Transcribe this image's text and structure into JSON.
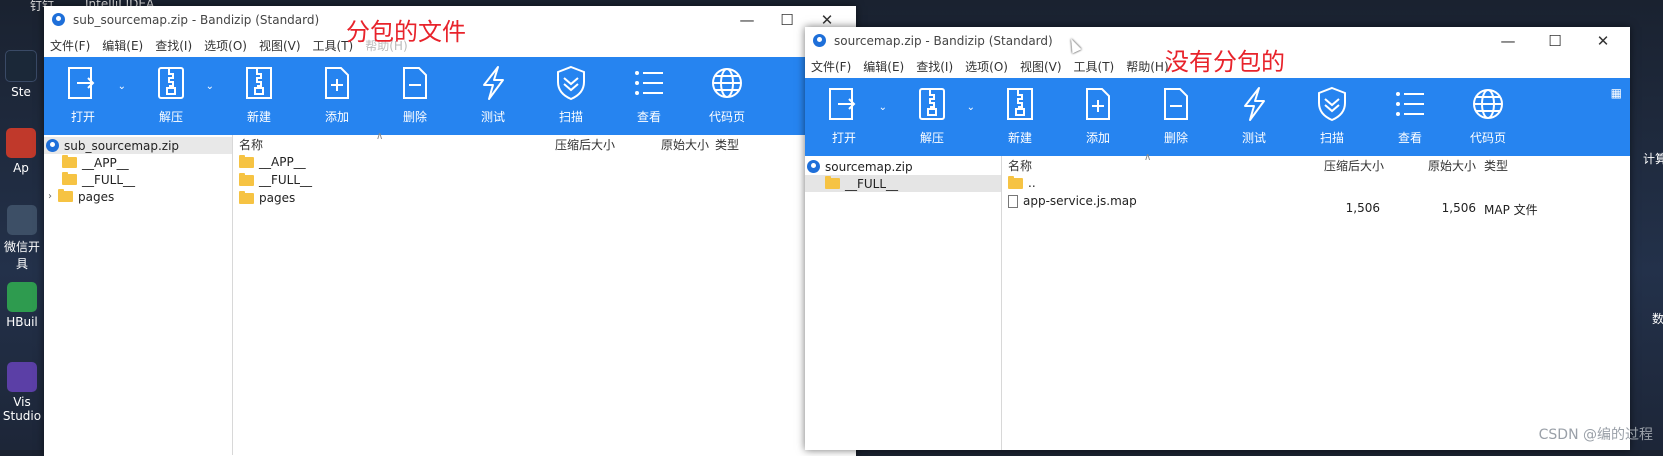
{
  "desktop": {
    "top_left_label": "钉钉",
    "top_right_label": "IntelliJ IDEA",
    "icons": [
      {
        "label": "Ste",
        "icon": "steam-icon",
        "color": "#1b2838"
      },
      {
        "label": "Ap",
        "icon": "app-icon",
        "color": "#c0392b"
      },
      {
        "label": "微信开",
        "sub": "具",
        "icon": "wechat-devtools-icon",
        "color": "#2c3e50"
      },
      {
        "label": "HBuil",
        "icon": "hbuilder-icon",
        "color": "#2e9b4f"
      },
      {
        "label": "Vis",
        "sub": "Studio",
        "icon": "visual-studio-icon",
        "color": "#2c3e50"
      }
    ],
    "right_labels": [
      "计算",
      "数"
    ]
  },
  "window_left": {
    "title": "sub_sourcemap.zip - Bandizip (Standard)",
    "menu": [
      "文件(F)",
      "编辑(E)",
      "查找(I)",
      "选项(O)",
      "视图(V)",
      "工具(T)",
      "帮助(H)"
    ],
    "toolbar": [
      {
        "label": "打开",
        "icon": "open-icon",
        "dropdown": true
      },
      {
        "label": "解压",
        "icon": "extract-icon",
        "dropdown": true
      },
      {
        "label": "新建",
        "icon": "new-archive-icon"
      },
      {
        "label": "添加",
        "icon": "add-file-icon"
      },
      {
        "label": "删除",
        "icon": "delete-file-icon"
      },
      {
        "label": "测试",
        "icon": "test-icon"
      },
      {
        "label": "扫描",
        "icon": "scan-shield-icon"
      },
      {
        "label": "查看",
        "icon": "view-list-icon"
      },
      {
        "label": "代码页",
        "icon": "codepage-globe-icon"
      }
    ],
    "tree": {
      "root": "sub_sourcemap.zip",
      "children": [
        "__APP__",
        "__FULL__",
        "pages"
      ]
    },
    "columns": {
      "name": "名称",
      "packed": "压缩后大小",
      "original": "原始大小",
      "type": "类型"
    },
    "rows": [
      {
        "name": "__APP__",
        "kind": "folder"
      },
      {
        "name": "__FULL__",
        "kind": "folder"
      },
      {
        "name": "pages",
        "kind": "folder"
      }
    ],
    "annotation": "分包的文件"
  },
  "window_right": {
    "title": "sourcemap.zip - Bandizip (Standard)",
    "menu": [
      "文件(F)",
      "编辑(E)",
      "查找(I)",
      "选项(O)",
      "视图(V)",
      "工具(T)",
      "帮助(H)"
    ],
    "toolbar": [
      {
        "label": "打开",
        "icon": "open-icon",
        "dropdown": true
      },
      {
        "label": "解压",
        "icon": "extract-icon",
        "dropdown": true
      },
      {
        "label": "新建",
        "icon": "new-archive-icon"
      },
      {
        "label": "添加",
        "icon": "add-file-icon"
      },
      {
        "label": "删除",
        "icon": "delete-file-icon"
      },
      {
        "label": "测试",
        "icon": "test-icon"
      },
      {
        "label": "扫描",
        "icon": "scan-shield-icon"
      },
      {
        "label": "查看",
        "icon": "view-list-icon"
      },
      {
        "label": "代码页",
        "icon": "codepage-globe-icon"
      }
    ],
    "tree": {
      "root": "sourcemap.zip",
      "children": [
        "__FULL__"
      ]
    },
    "columns": {
      "name": "名称",
      "packed": "压缩后大小",
      "original": "原始大小",
      "type": "类型"
    },
    "rows": [
      {
        "name": "..",
        "kind": "folder",
        "packed": "",
        "original": "",
        "type": ""
      },
      {
        "name": "app-service.js.map",
        "kind": "file",
        "packed": "1,506",
        "original": "1,506",
        "type": "MAP 文件"
      }
    ],
    "annotation": "没有分包的"
  },
  "watermark": "CSDN @编的过程",
  "colors": {
    "toolbar_blue": "#2684f0",
    "annotation_red": "#e8232b"
  }
}
